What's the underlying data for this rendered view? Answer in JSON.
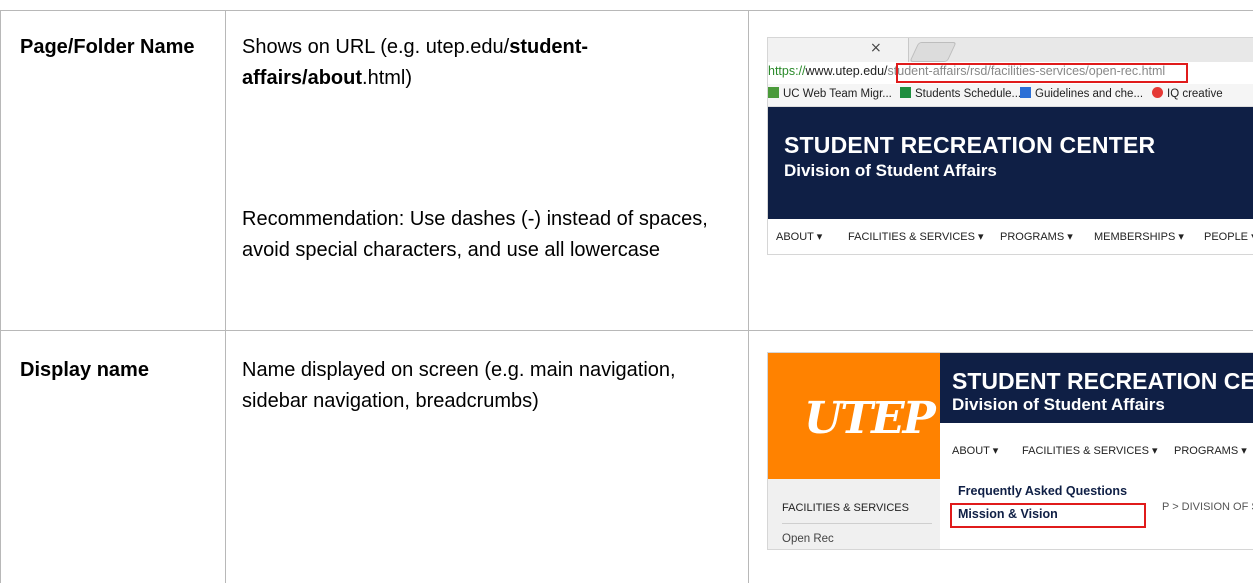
{
  "row1": {
    "label": "Page/Folder Name",
    "desc_prefix": "Shows on URL (e.g. utep.edu/",
    "desc_bold": "student-affairs/about",
    "desc_suffix": ".html)",
    "recommendation": "Recommendation:  Use dashes (-) instead of spaces, avoid special characters, and use all lowercase"
  },
  "row2": {
    "label": "Display name",
    "desc": "Name displayed on screen (e.g. main navigation, sidebar navigation, breadcrumbs)"
  },
  "browser": {
    "tab_close": "×",
    "url_scheme": "https://",
    "url_host": "www.utep.edu/",
    "url_path": "student-affairs/rsd/facilities-services/open-rec.html",
    "bookmarks": [
      "UC Web Team Migr...",
      "Students Schedule...",
      "Guidelines and che...",
      "IQ creative"
    ],
    "bookmark_colors": [
      "#4a9a3a",
      "#1e8e3e",
      "#2b6fd6",
      "#e53935"
    ]
  },
  "site": {
    "title": "STUDENT RECREATION CENTER",
    "subtitle": "Division of Student Affairs",
    "title_cropped": "STUDENT RECREATION CEN",
    "logo": "UTEP",
    "nav": [
      "ABOUT ▾",
      "FACILITIES & SERVICES ▾",
      "PROGRAMS ▾",
      "MEMBERSHIPS ▾",
      "PEOPLE ▾"
    ],
    "nav2": [
      "ABOUT ▾",
      "FACILITIES & SERVICES ▾",
      "PROGRAMS ▾"
    ],
    "sidebar_heading": "FACILITIES & SERVICES",
    "sidebar_item": "Open Rec",
    "dropdown_items": [
      "Frequently Asked Questions",
      "Mission & Vision"
    ],
    "breadcrumb": "P  >  DIVISION OF ST"
  },
  "colors": {
    "navy": "#0f1f45",
    "orange": "#ff8200",
    "highlight_red": "#e01b1b"
  }
}
